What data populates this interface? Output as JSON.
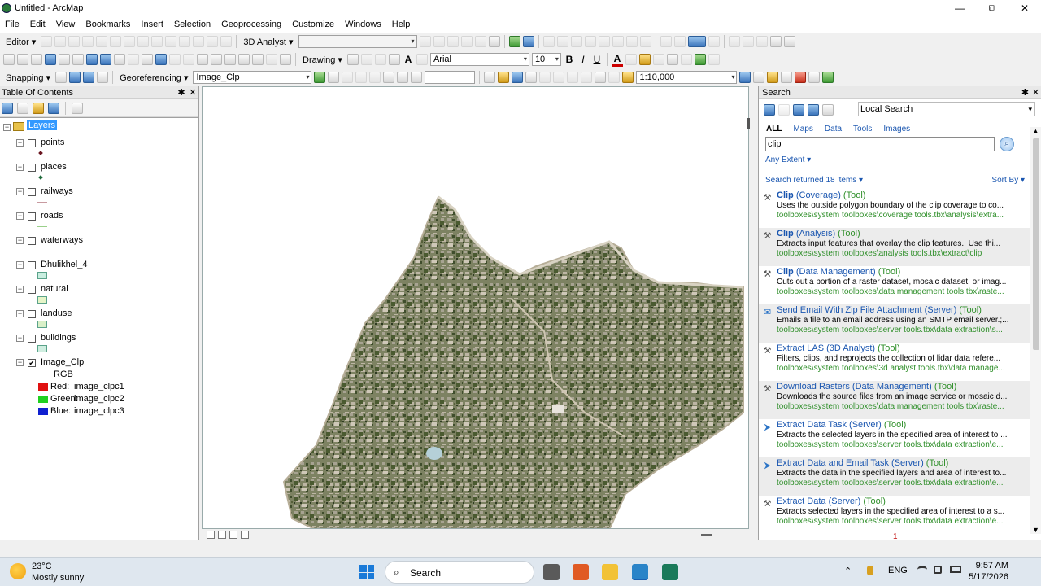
{
  "window": {
    "title": "Untitled - ArcMap",
    "controls": [
      "—",
      "⧉",
      "✕"
    ]
  },
  "menu": [
    "File",
    "Edit",
    "View",
    "Bookmarks",
    "Insert",
    "Selection",
    "Geoprocessing",
    "Customize",
    "Windows",
    "Help"
  ],
  "toolbars": {
    "editor_label": "Editor ▾",
    "analyst_label": "3D Analyst ▾",
    "drawing_label": "Drawing ▾",
    "font_name": "Arial",
    "font_size": "10",
    "bold": "B",
    "italic": "I",
    "underline": "U",
    "font_color_glyph": "A",
    "snapping_label": "Snapping ▾",
    "georef_label": "Georeferencing ▾",
    "georef_layer": "Image_Clp",
    "scale": "1:10,000"
  },
  "toc": {
    "title": "Table Of Contents",
    "pin": "✱",
    "close": "✕",
    "root": "Layers",
    "layers": [
      {
        "name": "points",
        "checked": false,
        "symbol": "point",
        "color": "#6a1520"
      },
      {
        "name": "places",
        "checked": false,
        "symbol": "point",
        "color": "#1e6a3a"
      },
      {
        "name": "railways",
        "checked": false,
        "symbol": "line",
        "color": "#c89aa0"
      },
      {
        "name": "roads",
        "checked": false,
        "symbol": "line",
        "color": "#9ad08a"
      },
      {
        "name": "waterways",
        "checked": false,
        "symbol": "line",
        "color": "#9ab0d8"
      },
      {
        "name": "Dhulikhel_4",
        "checked": false,
        "symbol": "poly",
        "color": "#c9eee0"
      },
      {
        "name": "natural",
        "checked": false,
        "symbol": "poly",
        "color": "#e6f5c8"
      },
      {
        "name": "landuse",
        "checked": false,
        "symbol": "poly",
        "color": "#d9f0c8"
      },
      {
        "name": "buildings",
        "checked": false,
        "symbol": "poly",
        "color": "#cfeee0"
      },
      {
        "name": "Image_Clp",
        "checked": true,
        "symbol": "raster",
        "color": ""
      }
    ],
    "raster": {
      "rgb_label": "RGB",
      "bands": [
        {
          "label": "Red:",
          "value": "image_clpc1",
          "color": "#e01010"
        },
        {
          "label": "Green:",
          "value": "image_clpc2",
          "color": "#20d020"
        },
        {
          "label": "Blue:",
          "value": "image_clpc3",
          "color": "#1020d0"
        }
      ]
    },
    "check_mark": "✔",
    "collapse_mark": "−"
  },
  "search": {
    "title": "Search",
    "pin": "✱",
    "close": "✕",
    "scope": "Local Search",
    "tabs": [
      "ALL",
      "Maps",
      "Data",
      "Tools",
      "Images"
    ],
    "active_tab": "ALL",
    "query": "clip",
    "extent": "Any Extent ▾",
    "returned": "Search returned 18 items ▾",
    "sort": "Sort By ▾",
    "page": "1",
    "results": [
      {
        "name": "Clip",
        "name_rest": " (Coverage)",
        "type": " (Tool)",
        "desc": "Uses the outside polygon boundary of the clip coverage to co...",
        "path": "toolboxes\\system toolboxes\\coverage tools.tbx\\analysis\\extra...",
        "icon": "hammer"
      },
      {
        "name": "Clip",
        "name_rest": " (Analysis)",
        "type": " (Tool)",
        "desc": "Extracts input features that overlay the clip features.; Use thi...",
        "path": "toolboxes\\system toolboxes\\analysis tools.tbx\\extract\\clip",
        "icon": "hammer"
      },
      {
        "name": "Clip",
        "name_rest": " (Data Management)",
        "type": " (Tool)",
        "desc": "Cuts out a portion of a raster dataset, mosaic dataset, or imag...",
        "path": "toolboxes\\system toolboxes\\data management tools.tbx\\raste...",
        "icon": "hammer"
      },
      {
        "name": "",
        "name_rest": "Send Email With Zip File Attachment (Server)",
        "type": " (Tool)",
        "desc": "Emails a file to an email address using an SMTP email server.;...",
        "path": "toolboxes\\system toolboxes\\server tools.tbx\\data extraction\\s...",
        "icon": "script"
      },
      {
        "name": "",
        "name_rest": "Extract LAS (3D Analyst)",
        "type": " (Tool)",
        "desc": "Filters, clips, and reprojects the collection of lidar data refere...",
        "path": "toolboxes\\system toolboxes\\3d analyst tools.tbx\\data manage...",
        "icon": "hammer"
      },
      {
        "name": "",
        "name_rest": "Download Rasters (Data Management)",
        "type": " (Tool)",
        "desc": "Downloads the source files from an image service or mosaic d...",
        "path": "toolboxes\\system toolboxes\\data management tools.tbx\\raste...",
        "icon": "hammer"
      },
      {
        "name": "",
        "name_rest": "Extract Data Task (Server)",
        "type": " (Tool)",
        "desc": "Extracts the selected layers in the specified area of interest to ...",
        "path": "toolboxes\\system toolboxes\\server tools.tbx\\data extraction\\e...",
        "icon": "model"
      },
      {
        "name": "",
        "name_rest": "Extract Data and Email Task (Server)",
        "type": " (Tool)",
        "desc": "Extracts the data in the specified layers and area of interest to...",
        "path": "toolboxes\\system toolboxes\\server tools.tbx\\data extraction\\e...",
        "icon": "model"
      },
      {
        "name": "",
        "name_rest": "Extract Data (Server)",
        "type": " (Tool)",
        "desc": "Extracts selected layers in the specified area of interest to a s...",
        "path": "toolboxes\\system toolboxes\\server tools.tbx\\data extraction\\e...",
        "icon": "hammer"
      }
    ]
  },
  "taskbar": {
    "temp": "23°C",
    "condition": "Mostly sunny",
    "search_label": "Search",
    "search_glyph": "⌕",
    "language": "ENG",
    "tray_chevron": "⌃",
    "time": "9:57 AM",
    "date": "5/17/2026"
  },
  "colors": {
    "link": "#1a56b0",
    "path_green": "#2f8f2a",
    "selection": "#3399ff"
  }
}
